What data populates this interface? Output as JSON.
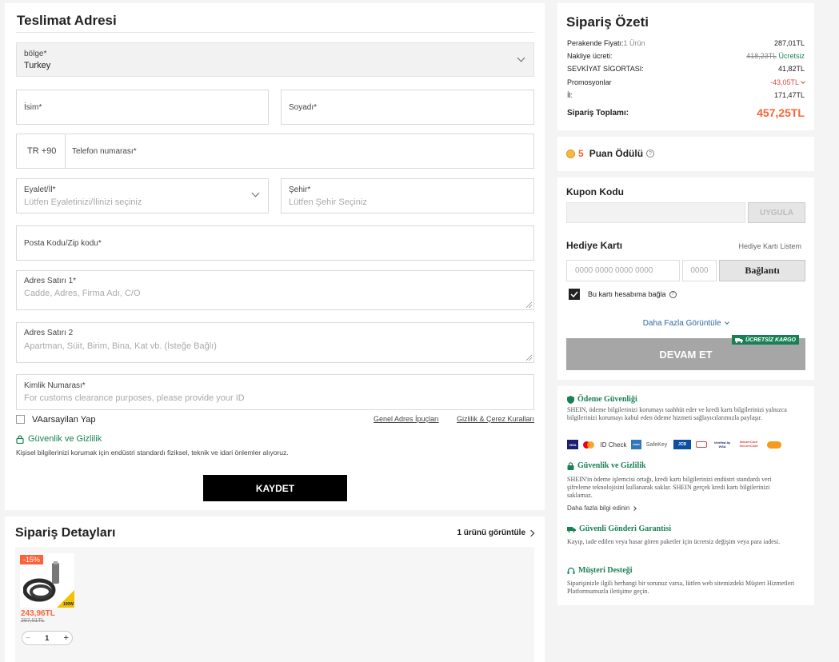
{
  "address": {
    "title": "Teslimat Adresi",
    "region_label": "bölge*",
    "region_value": "Turkey",
    "first_name_label": "İsim*",
    "last_name_label": "Soyadı*",
    "phone_prefix": "TR +90",
    "phone_label": "Telefon numarası*",
    "state_label": "Eyalet/İl*",
    "state_placeholder": "Lütfen Eyaletinizi/İlinizi seçiniz",
    "city_label": "Şehir*",
    "city_placeholder": "Lütfen Şehir Seçiniz",
    "zip_label": "Posta Kodu/Zip kodu*",
    "address1_label": "Adres Satırı 1*",
    "address1_placeholder": "Cadde, Adres, Firma Adı, C/O",
    "address2_label": "Adres Satırı 2",
    "address2_placeholder": "Apartman, Süit, Birim, Bina, Kat vb. (İsteğe Bağlı)",
    "id_label": "Kimlik Numarası*",
    "id_placeholder": "For customs clearance purposes, please provide your ID",
    "default_label": "VAarsayilan Yap",
    "tips_link": "Genel Adres İpuçları",
    "privacy_link": "Gizlilik & Çerez Kuralları",
    "security_title": "Güvenlik ve Gizlilik",
    "security_text": "Kişisel bilgilerinizi korumak için endüstri standardı fiziksel, teknik ve idari önlemler alıyoruz.",
    "save_label": "KAYDET"
  },
  "details": {
    "title": "Sipariş Detayları",
    "view_link": "1 ürünü görüntüle",
    "discount_badge": "-15%",
    "price": "243,96TL",
    "old_price": "287,01TL",
    "quantity": "1",
    "minus": "−",
    "plus": "+",
    "product_tag": "100W"
  },
  "summary": {
    "title": "Sipariş Özeti",
    "retail_label": "Perakende Fiyatı:",
    "retail_count": "1 Ürün",
    "retail_value": "287,01TL",
    "shipping_label": "Nakliye ücreti:",
    "shipping_old": "418,23TL",
    "shipping_value": "Ücretsiz",
    "insurance_label": "SEVKİYAT SİGORTASI:",
    "insurance_value": "41,82TL",
    "promo_label": "Promosyonlar",
    "promo_value": "-43,05TL",
    "tax_label": "İl:",
    "tax_value": "171,47TL",
    "total_label": "Sipariş Toplamı:",
    "total_value": "457,25TL"
  },
  "points": {
    "count": "5",
    "label": "Puan Ödülü"
  },
  "coupon": {
    "title": "Kupon Kodu",
    "apply_label": "UYGULA",
    "gift_title": "Hediye Kartı",
    "gift_list_link": "Hediye Kartı Listem",
    "card_placeholder": "0000 0000 0000 0000",
    "pin_placeholder": "0000",
    "connect_label": "Bağlantı",
    "bind_label": "Bu kartı hesabıma bağla",
    "more_label": "Daha Fazla Görüntüle",
    "free_shipping_badge": "ÜCRETSİZ KARGO",
    "continue_label": "DEVAM ET"
  },
  "trust": {
    "pay_title": "Ödeme Güvenliği",
    "pay_text": "SHEIN, ödeme bilgilerinizi korumayı taahhüt eder ve kredi kartı bilgilerinizi yalnızca bilgilerinizi korumayı kabul eden ödeme hizmeti sağlayıcılarımızla paylaşır.",
    "pay_icons": [
      "VISA",
      "",
      "ID Check",
      "AMEX",
      "SafeKey",
      "JCB",
      "",
      "Verified by VISA",
      "MasterCard SecureCode",
      ""
    ],
    "sec_title": "Güvenlik ve Gizlilik",
    "sec_text": "SHEIN'in ödeme işlemcisi ortağı, kredi kartı bilgilerinizi endüstri standardı veri şifreleme teknolojisini kullanarak saklar. SHEIN gerçek kredi kartı bilgilerinizi saklamaz.",
    "more_info": "Daha fazla bilgi edinin",
    "ship_title": "Güvenli Gönderi Garantisi",
    "ship_text": "Kayıp, iade edilen veya hasar gören paketler için ücretsiz değişim veya para iadesi.",
    "support_title": "Müşteri Desteği",
    "support_text": "Siparişinizle ilgili herhangi bir sorunuz varsa, lütfen web sitemizdeki Müşteri Hizmetleri Platformumuzla iletişime geçin."
  },
  "colors": {
    "accent_red": "#e64545",
    "trust_green": "#198055",
    "primary_black": "#000000",
    "disabled_gray": "#a6a6a6"
  }
}
